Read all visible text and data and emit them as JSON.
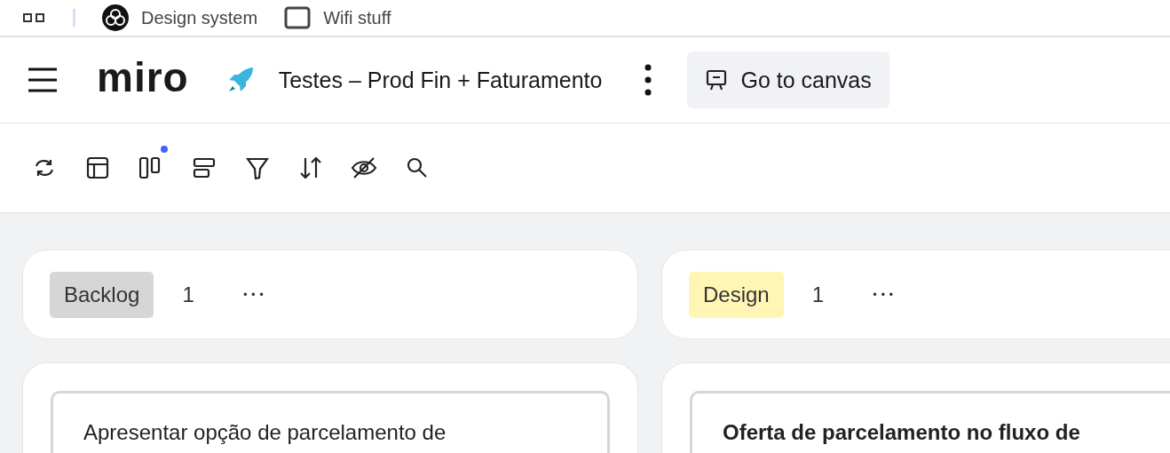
{
  "bookmarks": [
    {
      "label": "Design system",
      "kind": "logo"
    },
    {
      "label": "Wifi stuff",
      "kind": "folder"
    }
  ],
  "header": {
    "logo": "miro",
    "board_title": "Testes – Prod Fin + Faturamento",
    "canvas_button": "Go to canvas"
  },
  "toolbar": [
    {
      "kind": "sync",
      "badge": false
    },
    {
      "kind": "layout",
      "badge": false
    },
    {
      "kind": "columns",
      "badge": true
    },
    {
      "kind": "rows",
      "badge": false
    },
    {
      "kind": "filter",
      "badge": false
    },
    {
      "kind": "sort",
      "badge": false
    },
    {
      "kind": "hide",
      "badge": false
    },
    {
      "kind": "search",
      "badge": false
    }
  ],
  "columns": [
    {
      "tag": "Backlog",
      "color": "#d6d6d6",
      "count": "1",
      "more": "•••",
      "cards": [
        {
          "kind": "plain",
          "title": "Apresentar opção de parcelamento de"
        }
      ]
    },
    {
      "tag": "Design",
      "color": "#fff6b6",
      "count": "1",
      "more": "•••",
      "cards": [
        {
          "kind": "bold",
          "title": "Oferta de parcelamento no fluxo de"
        }
      ]
    }
  ]
}
